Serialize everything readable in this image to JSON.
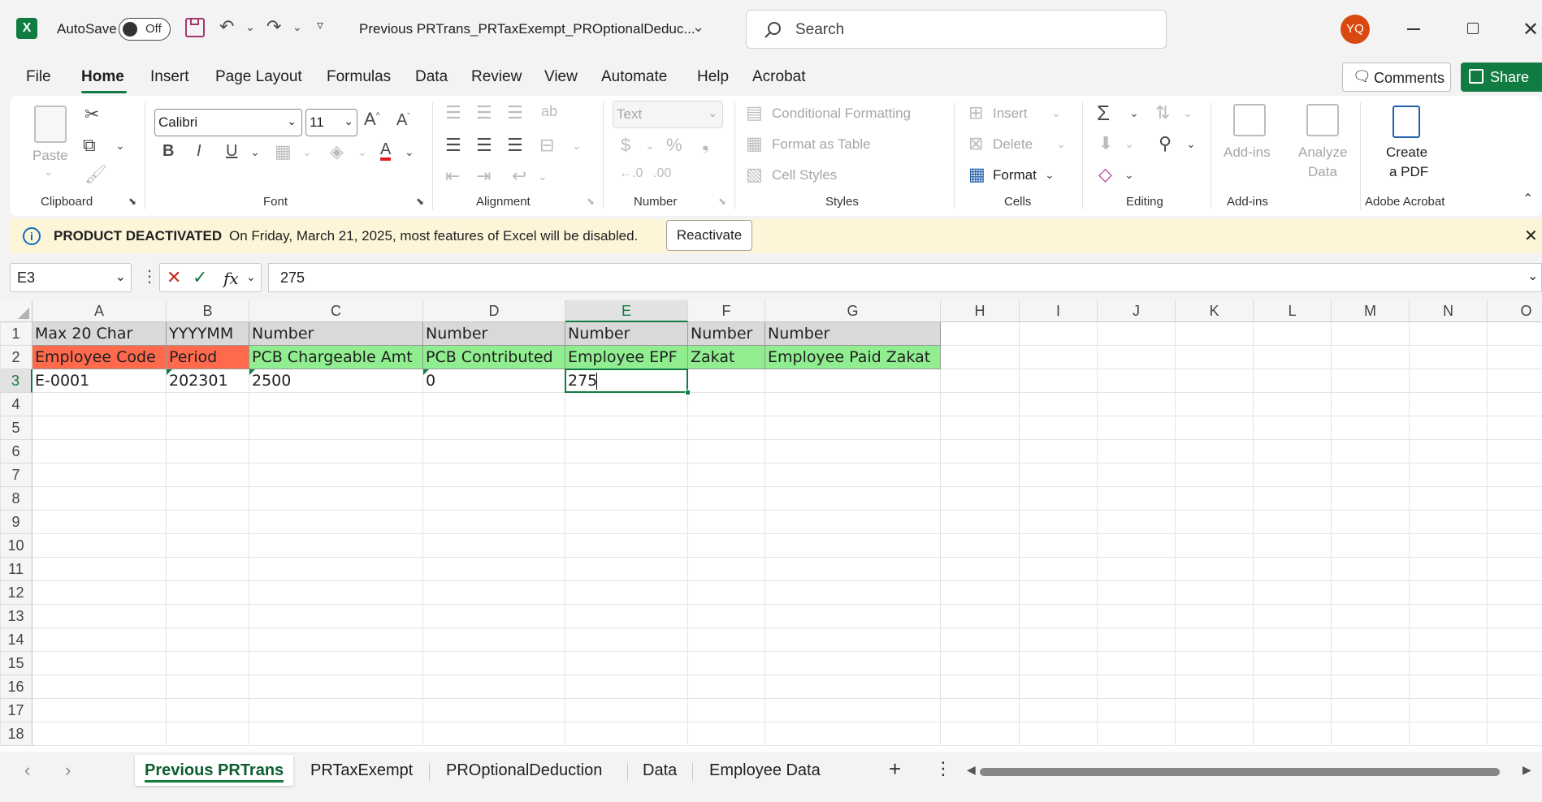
{
  "titlebar": {
    "autosave_label": "AutoSave",
    "autosave_state": "Off",
    "filename": "Previous PRTrans_PRTaxExempt_PROptionalDeduc...",
    "search_placeholder": "Search",
    "avatar_initials": "YQ"
  },
  "menu": {
    "items": [
      "File",
      "Home",
      "Insert",
      "Page Layout",
      "Formulas",
      "Data",
      "Review",
      "View",
      "Automate",
      "Help",
      "Acrobat"
    ],
    "active": "Home",
    "comments_label": "Comments",
    "share_label": "Share"
  },
  "ribbon": {
    "clipboard": {
      "label": "Clipboard",
      "paste": "Paste"
    },
    "font": {
      "label": "Font",
      "name": "Calibri",
      "size": "11"
    },
    "alignment": {
      "label": "Alignment"
    },
    "number": {
      "label": "Number",
      "format": "Text"
    },
    "styles": {
      "label": "Styles",
      "conditional": "Conditional Formatting",
      "format_table": "Format as Table",
      "cell_styles": "Cell Styles"
    },
    "cells": {
      "label": "Cells",
      "insert": "Insert",
      "delete": "Delete",
      "format": "Format"
    },
    "editing": {
      "label": "Editing"
    },
    "addins": {
      "label": "Add-ins",
      "button": "Add-ins",
      "analyze_1": "Analyze",
      "analyze_2": "Data"
    },
    "acrobat": {
      "label": "Adobe Acrobat",
      "create_1": "Create",
      "create_2": "a PDF"
    }
  },
  "infobar": {
    "title": "PRODUCT DEACTIVATED",
    "message": "On Friday, March 21, 2025, most features of Excel will be disabled.",
    "button": "Reactivate"
  },
  "formula_bar": {
    "name_box": "E3",
    "fx": "fx",
    "value": "275"
  },
  "sheet": {
    "columns": [
      "A",
      "B",
      "C",
      "D",
      "E",
      "F",
      "G",
      "H",
      "I",
      "J",
      "K",
      "L",
      "M",
      "N",
      "O"
    ],
    "rows": [
      "1",
      "2",
      "3",
      "4",
      "5",
      "6",
      "7",
      "8",
      "9",
      "10",
      "11",
      "12",
      "13",
      "14",
      "15",
      "16",
      "17",
      "18"
    ],
    "row1": [
      "Max 20 Char",
      "YYYYMM",
      "Number",
      "Number",
      "Number",
      "Number",
      "Number"
    ],
    "row2": [
      "Employee Code",
      "Period",
      "PCB Chargeable Amt",
      "PCB Contributed",
      "Employee EPF",
      "Zakat",
      "Employee Paid Zakat"
    ],
    "row3": [
      "E-0001",
      "202301",
      "2500",
      "0",
      "275"
    ],
    "colors": {
      "header_grey": "#d9d9d9",
      "required_red": "#ff6a4d",
      "optional_green": "#90ee90",
      "accent": "#107c41"
    }
  },
  "tabs": {
    "items": [
      "Previous PRTrans",
      "PRTaxExempt",
      "PROptionalDeduction",
      "Data",
      "Employee Data"
    ],
    "active": "Previous PRTrans"
  }
}
